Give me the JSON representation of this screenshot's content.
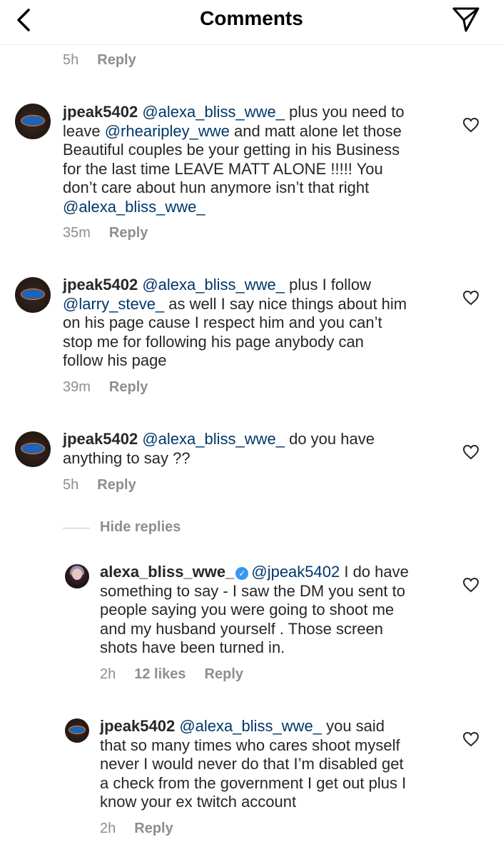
{
  "header": {
    "title": "Comments"
  },
  "top_meta": {
    "time": "5h",
    "reply_label": "Reply"
  },
  "comments": [
    {
      "username": "jpeak5402",
      "lines": [
        {
          "mention": "@alexa_bliss_wwe_",
          "text": " plus you need to"
        },
        {
          "text": "leave ",
          "mention": "@rhearipley_wwe",
          "text2": " and matt alone let those"
        },
        {
          "text": "Beautiful couples be your getting in his Business"
        },
        {
          "text": "for the last time  LEAVE MATT ALONE !!!!! You"
        },
        {
          "text": "don’t care about hun anymore isn’t that right"
        },
        {
          "mention": "@alexa_bliss_wwe_"
        }
      ],
      "time": "35m",
      "reply_label": "Reply"
    },
    {
      "username": "jpeak5402",
      "lines": [
        {
          "mention": "@alexa_bliss_wwe_",
          "text": " plus I follow"
        },
        {
          "mention": "@larry_steve_",
          "text": "  as well I say nice things about him"
        },
        {
          "text": "on his page cause I respect him  and you can’t"
        },
        {
          "text": "stop me for following his page anybody can"
        },
        {
          "text": "follow his page"
        }
      ],
      "time": "39m",
      "reply_label": "Reply"
    },
    {
      "username": "jpeak5402",
      "lines": [
        {
          "mention": "@alexa_bliss_wwe_",
          "text": " do you have"
        },
        {
          "text": "anything to say ??"
        }
      ],
      "time": "5h",
      "reply_label": "Reply"
    }
  ],
  "hide_replies_label": "Hide replies",
  "replies": [
    {
      "username": "alexa_bliss_wwe_",
      "verified": true,
      "lines": [
        {
          "mention": "@jpeak5402",
          "text": " I do have"
        },
        {
          "text": "something to say - I saw the DM you sent to"
        },
        {
          "text": "people saying you were going to shoot me"
        },
        {
          "text": "and my husband yourself . Those screen"
        },
        {
          "text": "shots have been turned in."
        }
      ],
      "time": "2h",
      "likes": "12 likes",
      "reply_label": "Reply"
    },
    {
      "username": "jpeak5402",
      "lines": [
        {
          "mention": "@alexa_bliss_wwe_",
          "text": "  you said"
        },
        {
          "text": "that so many times  who cares shoot myself"
        },
        {
          "text": "never I would never do that  I’m disabled get"
        },
        {
          "text": "a check from the government I get out plus I"
        },
        {
          "text": "know your ex twitch account"
        }
      ],
      "time": "2h",
      "reply_label": "Reply"
    }
  ],
  "colors": {
    "mention": "#00376b",
    "meta": "#8e8e8e",
    "verified": "#3897f0"
  }
}
